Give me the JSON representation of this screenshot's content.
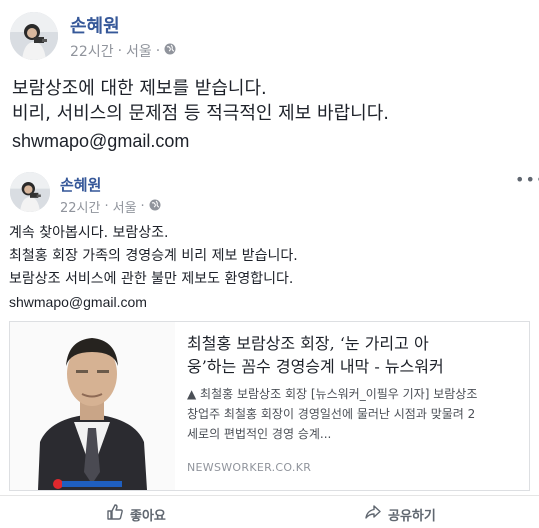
{
  "post1": {
    "author": "손혜원",
    "time": "22시간",
    "location": "서울",
    "separator": "·",
    "lines": [
      "보람상조에 대한 제보를 받습니다.",
      "비리, 서비스의 문제점 등 적극적인 제보 바랍니다."
    ],
    "email": "shwmapo@gmail.com",
    "privacy_icon": "globe-icon"
  },
  "post2": {
    "author": "손혜원",
    "time": "22시간",
    "location": "서울",
    "separator": "·",
    "more": "•••",
    "lines": [
      "계속 찾아봅시다. 보람상조.",
      "최철홍 회장 가족의 경영승계 비리 제보 받습니다.",
      "보람상조 서비스에 관한 불만 제보도 환영합니다."
    ],
    "email": "shwmapo@gmail.com",
    "link_card": {
      "title_line1": "최철홍 보람상조 회장, ‘눈 가리고 아",
      "title_line2": "웅’하는 꼼수 경영승계 내막 - 뉴스워커",
      "description_line1": "▲ 최철홍 보람상조 회장 [뉴스워커_이필우 기자] 보람상조",
      "description_line2": "창업주 최철홍 회장이 경영일선에 물러난 시점과 맞물려 2",
      "description_line3": "세로의 편법적인 경영 승계...",
      "domain": "NEWSWORKER.CO.KR"
    }
  },
  "actions": {
    "like_label": "좋아요",
    "share_label": "공유하기",
    "like_icon": "thumbs-up-icon",
    "share_icon": "share-arrow-icon"
  },
  "colors": {
    "name": "#365899",
    "meta": "#90949c",
    "text": "#1d2129",
    "border": "#dddfe2"
  }
}
